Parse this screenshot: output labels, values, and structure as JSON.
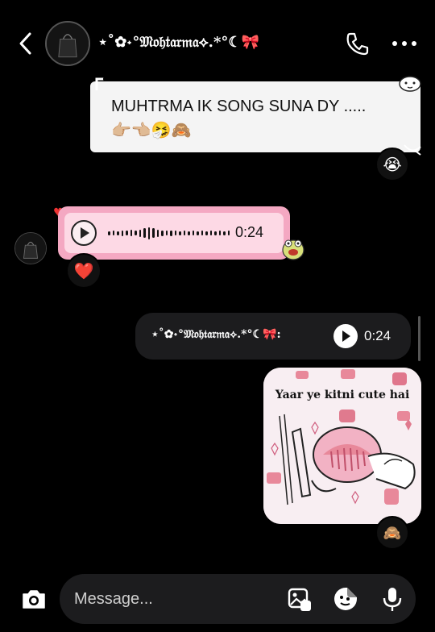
{
  "header": {
    "title": "⋆˚✿˖°𝔐𝔬𝔥𝔱𝔞𝔯𝔪𝔞⟡.*°☾🎀",
    "back_icon": "chevron-left-icon",
    "call_icon": "phone-icon",
    "more_icon": "more-horizontal-icon"
  },
  "messages": [
    {
      "text": "MUHTRMA IK SONG SUNA DY .....",
      "emoji_line": "👉🏼👈🏼🤧🙈",
      "reaction": "😭"
    },
    {
      "duration": "0:24",
      "reaction": "❤️"
    },
    {
      "sender_label": "⋆˚✿˖°𝔐𝔬𝔥𝔱𝔞𝔯𝔪𝔞⟡.*°☾🎀:",
      "duration": "0:24"
    },
    {
      "caption": "Yaar ye kitni cute hai",
      "reaction": "🙈"
    }
  ],
  "composer": {
    "placeholder": "Message..."
  },
  "colors": {
    "background": "#000000",
    "sent_bubble": "#f4f4f4",
    "pink_bubble": "#f4a8c2",
    "dark_bubble": "#1c1c1e"
  }
}
